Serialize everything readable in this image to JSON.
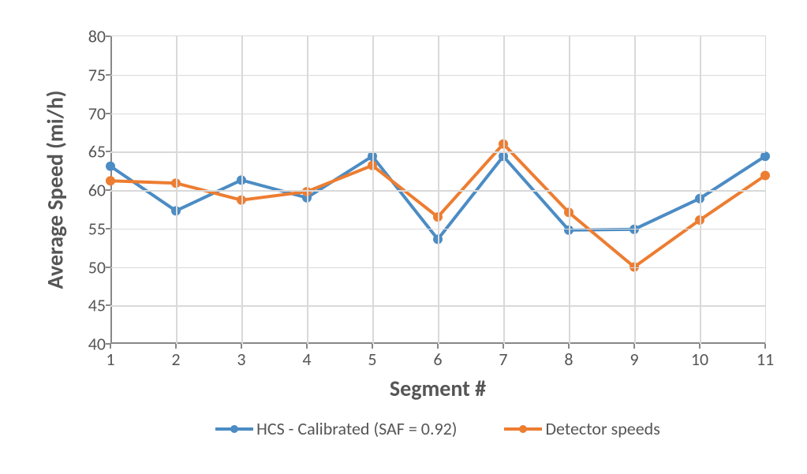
{
  "chart_data": {
    "type": "line",
    "xlabel": "Segment #",
    "ylabel": "Average Speed (mi/h)",
    "ylim": [
      40,
      80
    ],
    "yticks": [
      40,
      45,
      50,
      55,
      60,
      65,
      70,
      75,
      80
    ],
    "categories": [
      1,
      2,
      3,
      4,
      5,
      6,
      7,
      8,
      9,
      10,
      11
    ],
    "series": [
      {
        "name": "HCS - Calibrated (SAF = 0.92)",
        "color": "#4C8CC4",
        "values": [
          63.1,
          57.3,
          61.3,
          59.0,
          64.4,
          53.6,
          64.4,
          54.8,
          54.9,
          58.9,
          64.4
        ]
      },
      {
        "name": "Detector speeds",
        "color": "#ED7D31",
        "values": [
          61.2,
          60.9,
          58.7,
          59.8,
          63.2,
          56.5,
          66.0,
          57.1,
          50.0,
          56.1,
          61.9
        ]
      }
    ]
  }
}
